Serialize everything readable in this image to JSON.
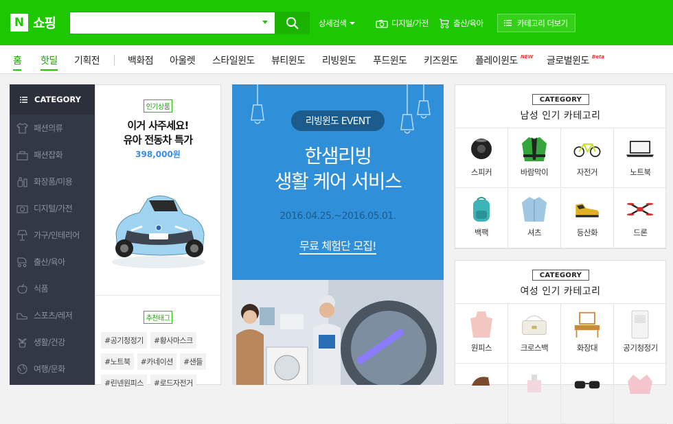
{
  "header": {
    "logo_mark": "N",
    "logo_text": "쇼핑",
    "search_placeholder": "",
    "advanced_search": "상세검색",
    "link_digital": "디지털/가전",
    "link_baby": "출산/육아",
    "more_categories": "카테고리 더보기"
  },
  "nav": {
    "items": [
      "홈",
      "핫딜",
      "기획전",
      "백화점",
      "아울렛",
      "스타일윈도",
      "뷰티윈도",
      "리빙윈도",
      "푸드윈도",
      "키즈윈도",
      "플레이윈도",
      "글로벌윈도"
    ],
    "new_badge": "NEW",
    "beta_badge": "Beta"
  },
  "sidebar": {
    "title": "CATEGORY",
    "items": [
      "패션의류",
      "패션잡화",
      "화장품/미용",
      "디지털/가전",
      "가구/인테리어",
      "출산/육아",
      "식품",
      "스포츠/레저",
      "생활/건강",
      "여행/문화"
    ]
  },
  "promo": {
    "tag": "인기상품",
    "title_line1": "이거 사주세요!",
    "title_line2": "유아 전동차 특가",
    "price": "398,000원",
    "recommended_tag": "추천태그",
    "hashtags": [
      "#공기청정기",
      "#황사마스크",
      "#노트북",
      "#카네이션",
      "#샌들",
      "#린넨원피스",
      "#로드자전거"
    ]
  },
  "banner": {
    "event": "리빙윈도 EVENT",
    "title_line1": "한샘리빙",
    "title_line2": "생활 케어 서비스",
    "date": "2016.04.25.~2016.05.01.",
    "cta": "무료 체험단 모집!"
  },
  "men_categories": {
    "label": "CATEGORY",
    "title": "남성 인기 카테고리",
    "items": [
      {
        "label": "스피커",
        "icon": "speaker-icon"
      },
      {
        "label": "바람막이",
        "icon": "windbreaker-icon"
      },
      {
        "label": "자전거",
        "icon": "bicycle-icon"
      },
      {
        "label": "노트북",
        "icon": "laptop-icon"
      },
      {
        "label": "백팩",
        "icon": "backpack-icon"
      },
      {
        "label": "셔츠",
        "icon": "shirt-icon"
      },
      {
        "label": "등산화",
        "icon": "hiking-shoe-icon"
      },
      {
        "label": "드론",
        "icon": "drone-icon"
      }
    ]
  },
  "women_categories": {
    "label": "CATEGORY",
    "title": "여성 인기 카테고리",
    "items": [
      {
        "label": "원피스",
        "icon": "dress-icon"
      },
      {
        "label": "크로스백",
        "icon": "crossbag-icon"
      },
      {
        "label": "화장대",
        "icon": "vanity-icon"
      },
      {
        "label": "공기청정기",
        "icon": "air-purifier-icon"
      }
    ]
  },
  "colors": {
    "brand_green": "#1ec800",
    "banner_blue": "#2f8fd8",
    "sidebar_bg": "#333845",
    "price_blue": "#3d8be6"
  }
}
